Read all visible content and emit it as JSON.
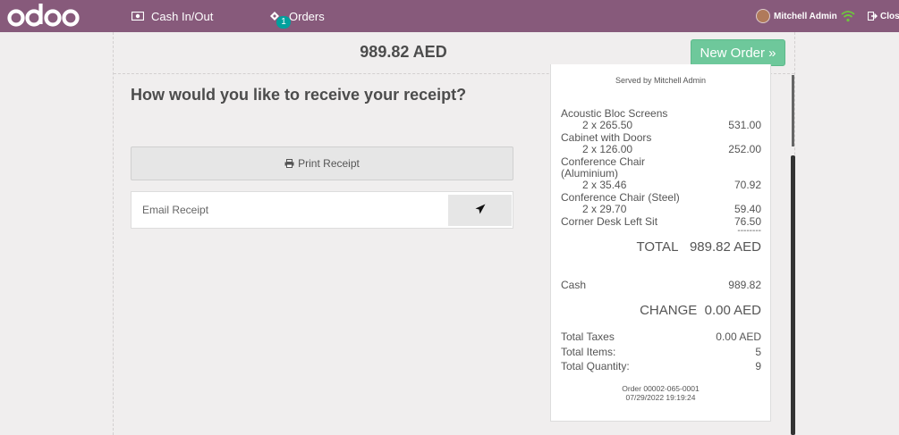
{
  "topbar": {
    "brand": "odoo",
    "cash_label": "Cash In/Out",
    "orders_label": "Orders",
    "orders_badge": "1",
    "user_name": "Mitchell Admin",
    "close_label": "Close",
    "bg_color": "#875a7b",
    "badge_color": "#00a09d",
    "icons": [
      "money-icon",
      "tickets-icon",
      "wifi-icon",
      "sign-out-icon"
    ]
  },
  "header": {
    "amount": "989.82 AED",
    "new_order_label": "New Order »",
    "new_order_color": "#6ec89b"
  },
  "receipt_options": {
    "question": "How would you like to receive your receipt?",
    "print_label": "Print Receipt",
    "email_placeholder": "Email Receipt",
    "icons": [
      "print-icon",
      "paper-plane-icon"
    ]
  },
  "receipt": {
    "served_by": "Served by Mitchell Admin",
    "items": [
      {
        "name": "Acoustic Bloc Screens",
        "qty_price": "2 x 265.50",
        "total": "531.00"
      },
      {
        "name": "Cabinet with Doors",
        "qty_price": "2 x 126.00",
        "total": "252.00"
      },
      {
        "name": "Conference Chair",
        "name2": "(Aluminium)",
        "qty_price": "2 x 35.46",
        "total": "70.92"
      },
      {
        "name": "Conference Chair (Steel)",
        "qty_price": "2 x 29.70",
        "total": "59.40"
      },
      {
        "name": "Corner Desk Left Sit",
        "total": "76.50"
      }
    ],
    "dashes": "--------",
    "total_label": "TOTAL",
    "total_value": "989.82 AED",
    "payment_label": "Cash",
    "payment_value": "989.82",
    "change_label": "CHANGE",
    "change_value": "0.00 AED",
    "taxes_label": "Total Taxes",
    "taxes_value": "0.00 AED",
    "items_label": "Total Items:",
    "items_value": "5",
    "quantity_label": "Total Quantity:",
    "quantity_value": "9",
    "order_ref": "Order 00002-065-0001",
    "order_date": "07/29/2022 19:19:24"
  }
}
